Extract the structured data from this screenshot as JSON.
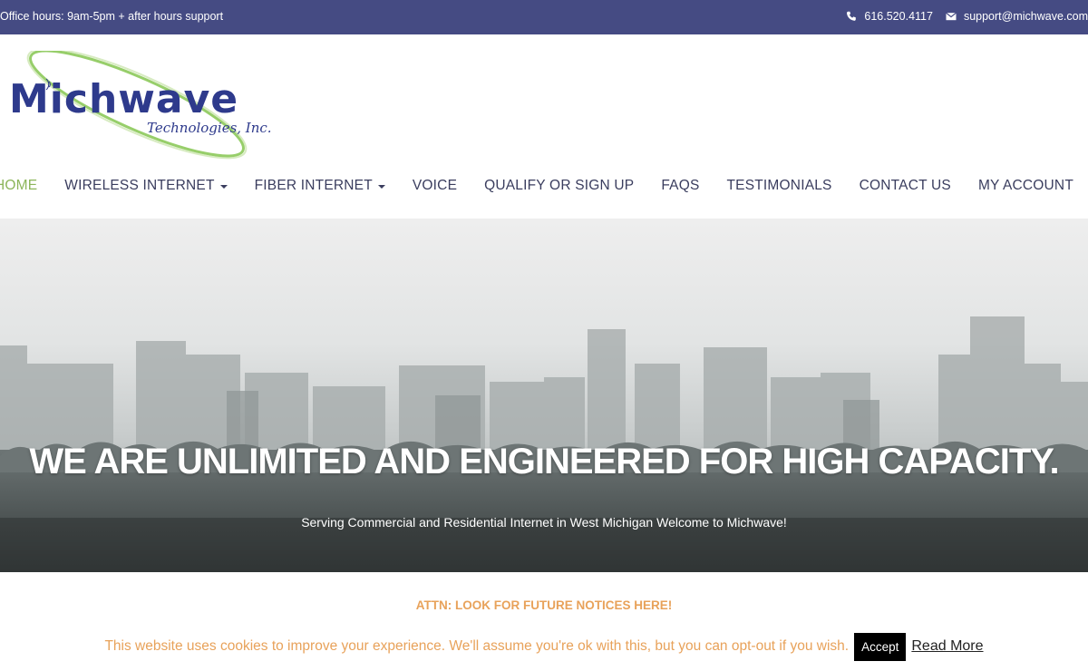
{
  "topbar": {
    "hours": "Office hours: 9am-5pm + after hours support",
    "phone": "616.520.4117",
    "email": "support@michwave.com",
    "phone_icon": "phone-icon",
    "email_icon": "envelope-icon"
  },
  "logo": {
    "name": "Michwave",
    "tagline": "Technologies, Inc."
  },
  "nav": {
    "items": [
      {
        "label": "HOME",
        "active": true
      },
      {
        "label": "WIRELESS INTERNET",
        "dropdown": true
      },
      {
        "label": "FIBER INTERNET",
        "dropdown": true
      },
      {
        "label": "VOICE"
      },
      {
        "label": "QUALIFY OR SIGN UP"
      },
      {
        "label": "FAQS"
      },
      {
        "label": "TESTIMONIALS"
      },
      {
        "label": "CONTACT US"
      },
      {
        "label": "MY ACCOUNT"
      }
    ]
  },
  "hero": {
    "headline_1": "WE ARE ",
    "headline_2": "UNLIMITED",
    "headline_3": " AND ",
    "headline_4": "ENGINEERED",
    "headline_5": " FOR HIGH CAPACITY.",
    "subtitle": "Serving Commercial and Residential Internet in West Michigan Welcome to Michwave!"
  },
  "notice": "ATTN: LOOK FOR FUTURE NOTICES HERE!",
  "cookie": {
    "message": "This website uses cookies to improve your experience. We'll assume you're ok with this, but you can opt-out if you wish.",
    "accept": "Accept",
    "read_more": "Read More"
  },
  "colors": {
    "topbar": "#454b83",
    "nav_text": "#3a3d5e",
    "nav_active": "#8cb55a",
    "notice": "#e8a25a",
    "logo_blue": "#2e3a8c",
    "logo_green": "#8cc95a"
  }
}
